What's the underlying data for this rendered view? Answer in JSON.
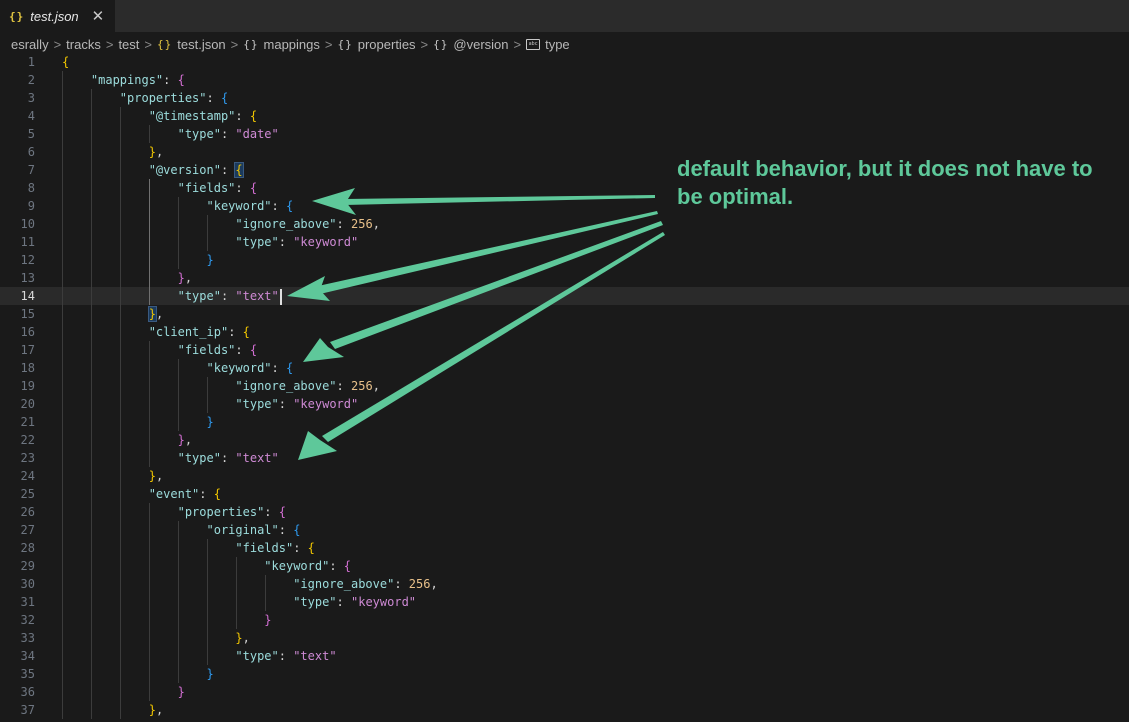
{
  "tab": {
    "icon": "json-braces-icon",
    "label": "test.json",
    "close_icon": "close-icon"
  },
  "breadcrumb": [
    {
      "label": "esrally",
      "icon": null
    },
    {
      "label": "tracks",
      "icon": null
    },
    {
      "label": "test",
      "icon": null
    },
    {
      "label": "test.json",
      "icon": "json-braces-icon"
    },
    {
      "label": "mappings",
      "icon": "object-braces-icon"
    },
    {
      "label": "properties",
      "icon": "object-braces-icon"
    },
    {
      "label": "@version",
      "icon": "object-braces-icon"
    },
    {
      "label": "type",
      "icon": "string-abc-icon"
    }
  ],
  "breadcrumb_separator": ">",
  "editor": {
    "current_line": 14,
    "lines": [
      {
        "n": "1",
        "t": "{"
      },
      {
        "n": "2",
        "t": "    \"mappings\": {"
      },
      {
        "n": "3",
        "t": "        \"properties\": {"
      },
      {
        "n": "4",
        "t": "            \"@timestamp\": {"
      },
      {
        "n": "5",
        "t": "                \"type\": \"date\""
      },
      {
        "n": "6",
        "t": "            },"
      },
      {
        "n": "7",
        "t": "            \"@version\": {"
      },
      {
        "n": "8",
        "t": "                \"fields\": {"
      },
      {
        "n": "9",
        "t": "                    \"keyword\": {"
      },
      {
        "n": "10",
        "t": "                        \"ignore_above\": 256,"
      },
      {
        "n": "11",
        "t": "                        \"type\": \"keyword\""
      },
      {
        "n": "12",
        "t": "                    }"
      },
      {
        "n": "13",
        "t": "                },"
      },
      {
        "n": "14",
        "t": "                \"type\": \"text\""
      },
      {
        "n": "15",
        "t": "            },"
      },
      {
        "n": "16",
        "t": "            \"client_ip\": {"
      },
      {
        "n": "17",
        "t": "                \"fields\": {"
      },
      {
        "n": "18",
        "t": "                    \"keyword\": {"
      },
      {
        "n": "19",
        "t": "                        \"ignore_above\": 256,"
      },
      {
        "n": "20",
        "t": "                        \"type\": \"keyword\""
      },
      {
        "n": "21",
        "t": "                    }"
      },
      {
        "n": "22",
        "t": "                },"
      },
      {
        "n": "23",
        "t": "                \"type\": \"text\""
      },
      {
        "n": "24",
        "t": "            },"
      },
      {
        "n": "25",
        "t": "            \"event\": {"
      },
      {
        "n": "26",
        "t": "                \"properties\": {"
      },
      {
        "n": "27",
        "t": "                    \"original\": {"
      },
      {
        "n": "28",
        "t": "                        \"fields\": {"
      },
      {
        "n": "29",
        "t": "                            \"keyword\": {"
      },
      {
        "n": "30",
        "t": "                                \"ignore_above\": 256,"
      },
      {
        "n": "31",
        "t": "                                \"type\": \"keyword\""
      },
      {
        "n": "32",
        "t": "                            }"
      },
      {
        "n": "33",
        "t": "                        },"
      },
      {
        "n": "34",
        "t": "                        \"type\": \"text\""
      },
      {
        "n": "35",
        "t": "                    }"
      },
      {
        "n": "36",
        "t": "                }"
      },
      {
        "n": "37",
        "t": "            },"
      }
    ]
  },
  "annotation": {
    "text": "default behavior, but it does not have to be optimal.",
    "color": "#5ec89a"
  },
  "colors": {
    "editor_bg": "#1a1a1a",
    "tabbar_bg": "#2b2b2b",
    "key": "#9cdcdc",
    "string": "#ce8ad4",
    "number": "#e8c08a",
    "bracket_level1": "#f2c700",
    "bracket_level2": "#d36fd3",
    "bracket_level3": "#2f9bf0",
    "arrow": "#5ec89a"
  }
}
